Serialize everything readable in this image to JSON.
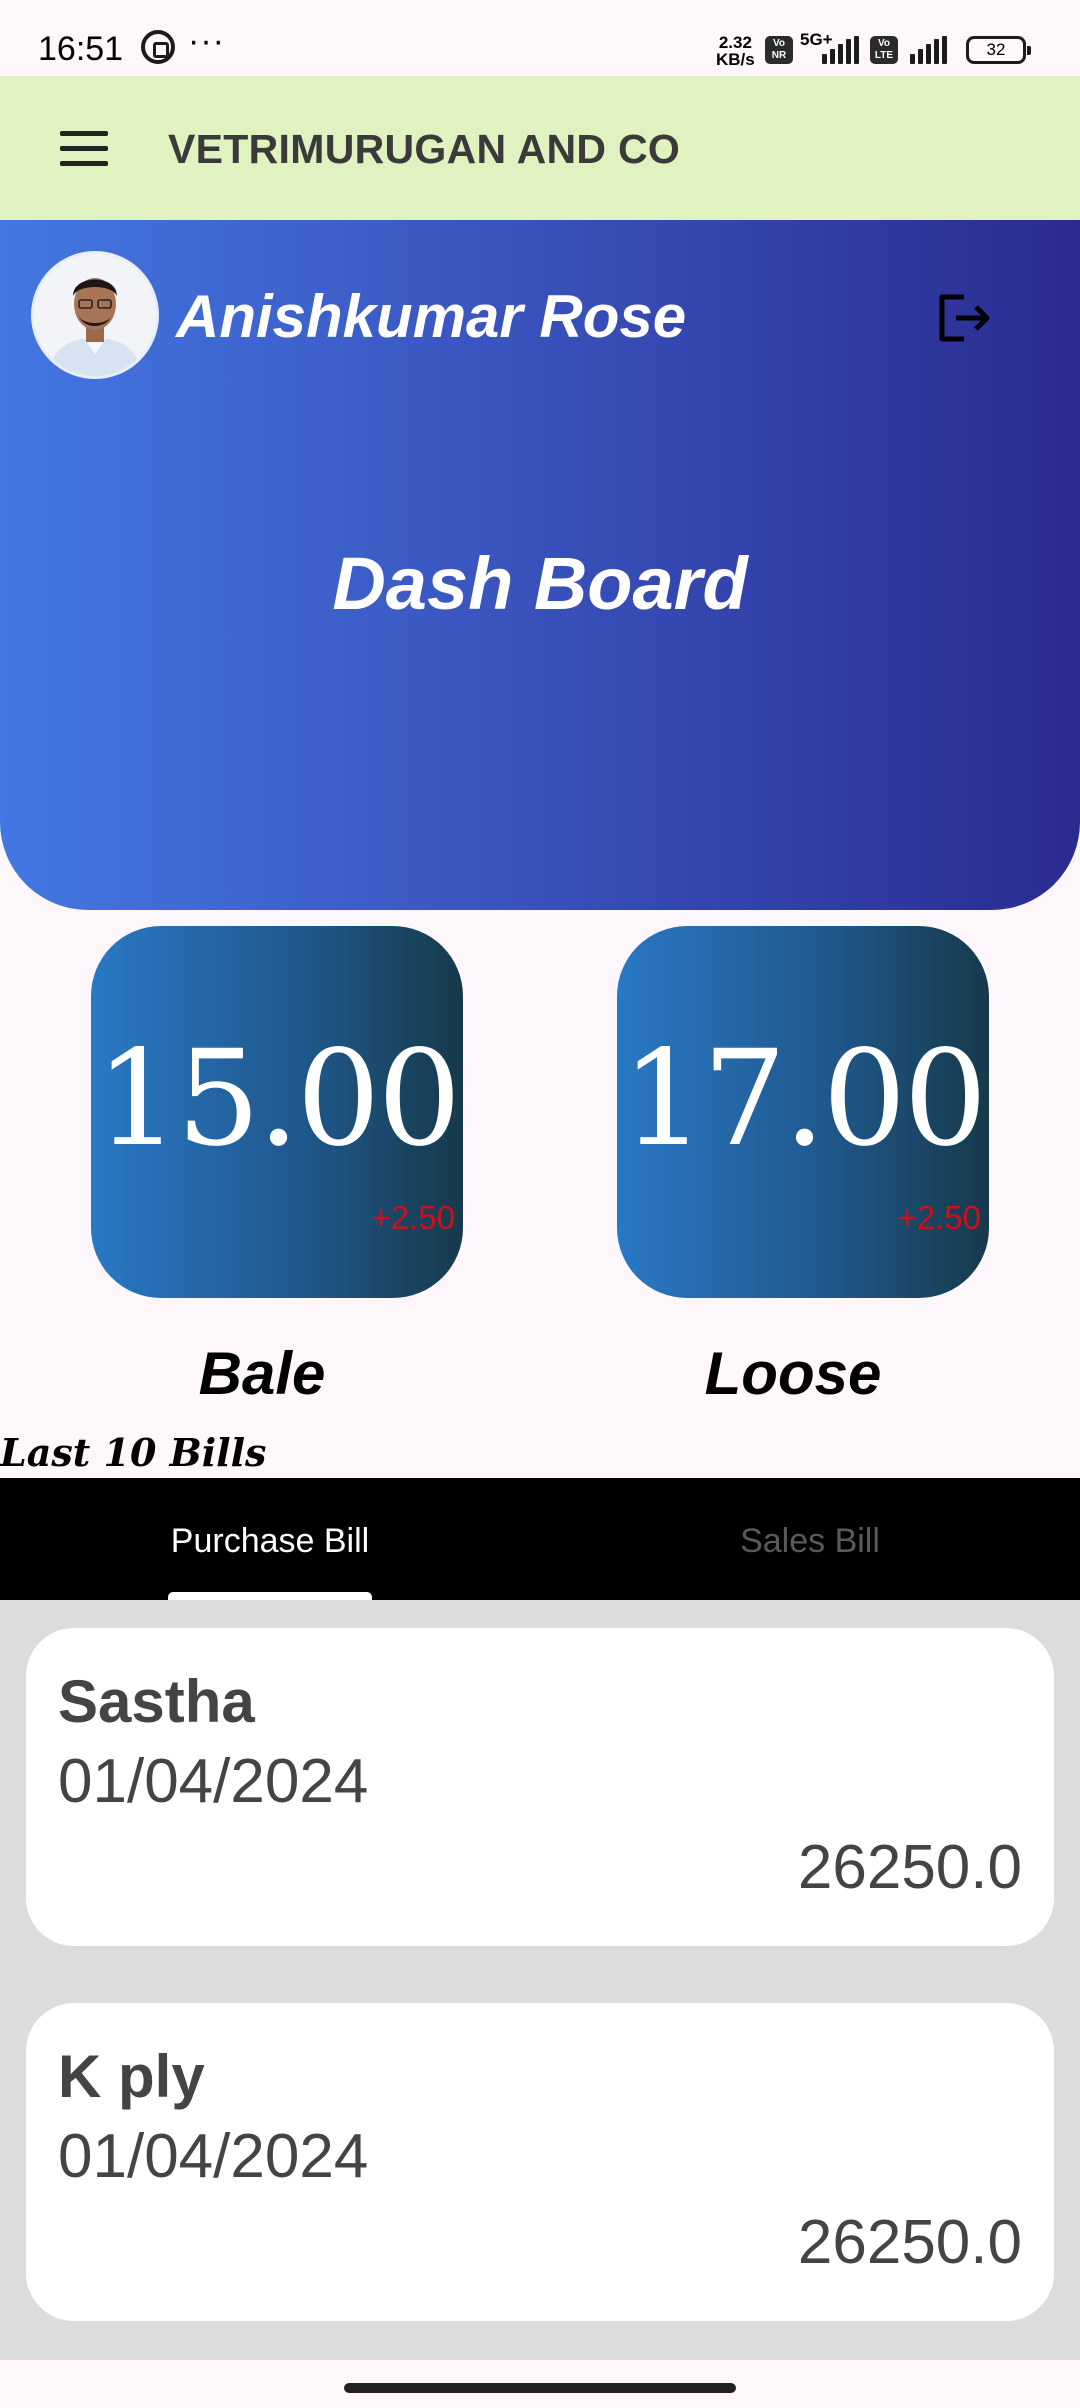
{
  "status_bar": {
    "time": "16:51",
    "more": "···",
    "speed": "2.32\nKB/s",
    "battery": "32",
    "network": "5G+"
  },
  "app_bar": {
    "title": "VETRIMURUGAN AND CO"
  },
  "header": {
    "user_name": "Anishkumar Rose",
    "dashboard_title": "Dash Board"
  },
  "stats": [
    {
      "value": "15.00",
      "delta": "+2.50",
      "label": "Bale"
    },
    {
      "value": "17.00",
      "delta": "+2.50",
      "label": "Loose"
    }
  ],
  "section_title": "Last 10 Bills",
  "tabs": [
    {
      "label": "Purchase Bill",
      "active": true
    },
    {
      "label": "Sales Bill",
      "active": false
    }
  ],
  "bills": [
    {
      "name": "Sastha",
      "date": "01/04/2024",
      "amount": "26250.0"
    },
    {
      "name": "K ply",
      "date": "01/04/2024",
      "amount": "26250.0"
    }
  ],
  "colors": {
    "app_bar": "#dff2c0",
    "header_start": "#4477e2",
    "header_end": "#2a2b90",
    "card_start": "#2978c5",
    "card_end": "#163a4a",
    "delta": "#c8121e"
  }
}
